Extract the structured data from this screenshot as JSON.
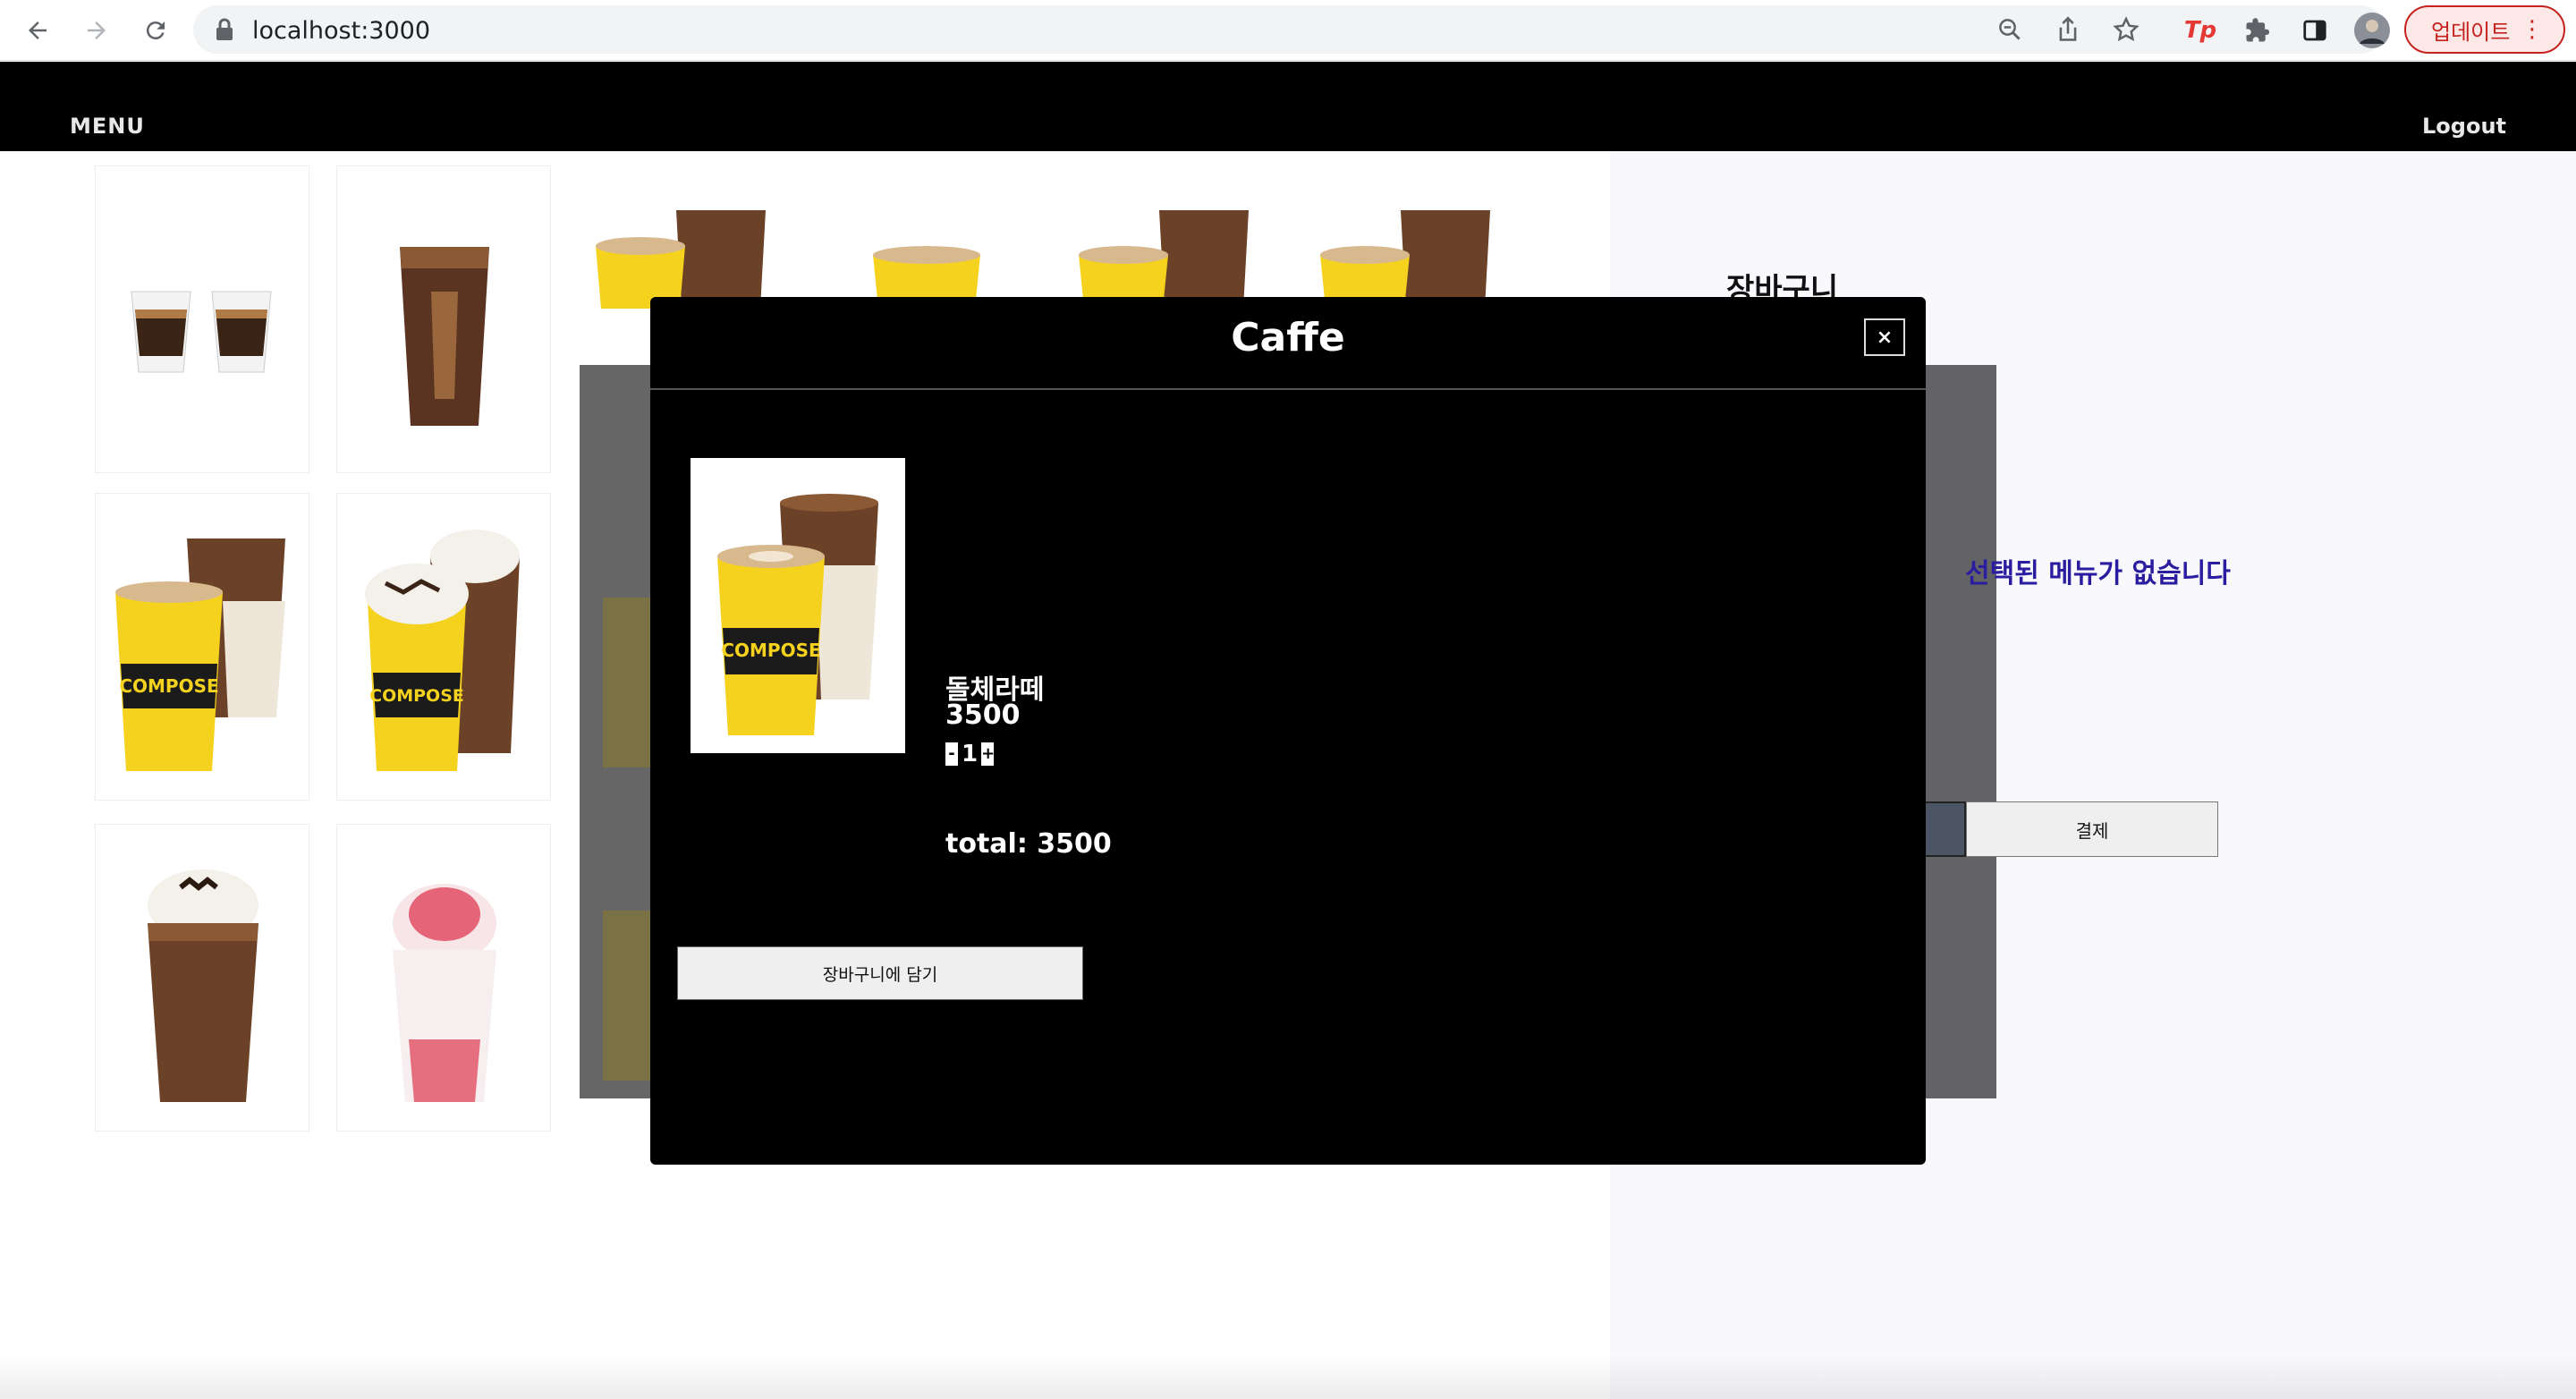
{
  "browser": {
    "url": "localhost:3000",
    "update_label": "업데이트",
    "menu_dots": "⋮",
    "ext_tp": "Tp"
  },
  "header": {
    "menu_label": "MENU",
    "logout_label": "Logout"
  },
  "cart": {
    "title": "장바구니",
    "empty_message": "선택된 메뉴가 없습니다",
    "pay_label": "결제"
  },
  "modal": {
    "title": "Caffe",
    "close_label": "×",
    "item": {
      "name": "돌체라떼",
      "price": "3500",
      "quantity": "1",
      "minus": "-",
      "plus": "+"
    },
    "total_label": "total: 3500",
    "add_to_cart_label": "장바구니에 담기"
  },
  "colors": {
    "header_bg": "#000000",
    "accent_text": "#2a1da0",
    "cup_yellow": "#f5d21e",
    "coffee_dark": "#3a2416"
  }
}
